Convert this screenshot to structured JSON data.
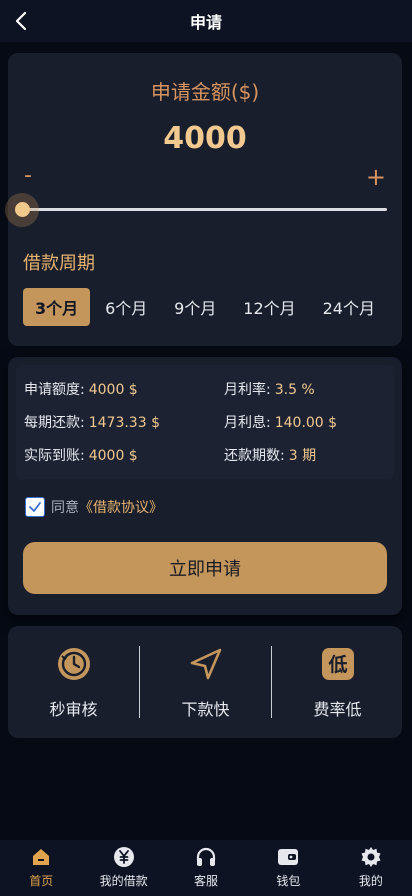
{
  "header": {
    "title": "申请"
  },
  "amount": {
    "label": "申请金额($)",
    "value": "4000",
    "minus": "-",
    "plus": "+",
    "slider_fraction": 0.0
  },
  "period": {
    "title": "借款周期",
    "options": [
      "3个月",
      "6个月",
      "9个月",
      "12个月",
      "24个月"
    ],
    "selected": "3个月"
  },
  "details": {
    "apply_limit": {
      "label": "申请额度:",
      "value": "4000 $"
    },
    "monthly_rate": {
      "label": "月利率:",
      "value": "3.5 %"
    },
    "installment": {
      "label": "每期还款:",
      "value": "1473.33 $"
    },
    "monthly_interest": {
      "label": "月利息:",
      "value": "140.00 $"
    },
    "actual_received": {
      "label": "实际到账:",
      "value": "4000 $"
    },
    "repay_periods": {
      "label": "还款期数:",
      "value": "3 期"
    }
  },
  "agreement": {
    "prefix": "同意",
    "link": "《借款协议》",
    "checked": true
  },
  "apply_button": "立即申请",
  "features": [
    {
      "label": "秒审核",
      "icon": "clock-history-icon"
    },
    {
      "label": "下款快",
      "icon": "send-arrow-icon"
    },
    {
      "label": "费率低",
      "icon": "low-rate-icon",
      "glyph": "低"
    }
  ],
  "nav": [
    {
      "label": "首页",
      "icon": "home-icon",
      "active": true
    },
    {
      "label": "我的借款",
      "icon": "yuan-coin-icon"
    },
    {
      "label": "客服",
      "icon": "headset-icon"
    },
    {
      "label": "钱包",
      "icon": "wallet-icon"
    },
    {
      "label": "我的",
      "icon": "gear-icon"
    }
  ],
  "colors": {
    "accent": "#c4965c",
    "gold_text": "#f2c98f",
    "background": "#050a14",
    "card": "#181e2c",
    "nav_active": "#e2a34f"
  }
}
